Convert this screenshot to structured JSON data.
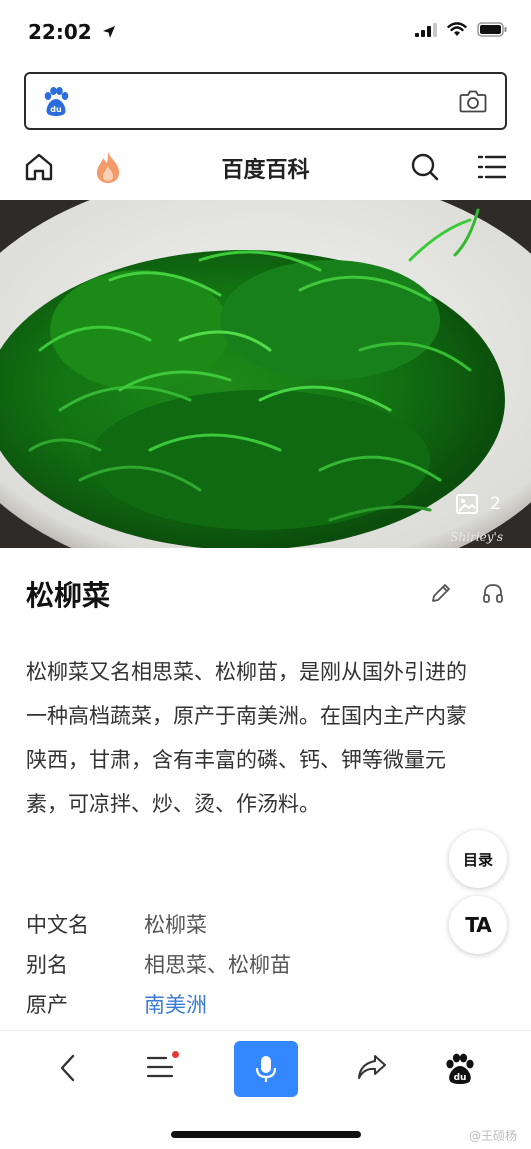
{
  "status_bar": {
    "time": "22:02"
  },
  "header": {
    "title": "百度百科"
  },
  "hero": {
    "image_count": "2",
    "watermark": "Shirley's"
  },
  "entry": {
    "title": "松柳菜",
    "summary": "松柳菜又名相思菜、松柳苗，是刚从国外引进的一种高档蔬菜，原产于南美洲。在国内主产内蒙陕西，甘肃，含有丰富的磷、钙、钾等微量元素，可凉拌、炒、烫、作汤料。"
  },
  "infobox": [
    {
      "key": "中文名",
      "value": "松柳菜"
    },
    {
      "key": "别名",
      "value": "相思菜、松柳苗"
    },
    {
      "key": "原产",
      "value": "南美洲"
    }
  ],
  "floating": {
    "toc_label": "目录",
    "ta_label": "TA"
  },
  "weibo_watermark": "@王硕杨",
  "icons": [
    "location-arrow-icon",
    "signal-icon",
    "wifi-icon",
    "battery-icon",
    "baidu-paw-icon",
    "camera-icon",
    "home-icon",
    "fire-icon",
    "search-icon",
    "menu-icon",
    "gallery-icon",
    "edit-icon",
    "headphones-icon",
    "back-icon",
    "microphone-icon",
    "share-icon"
  ],
  "colors": {
    "accent": "#3388ff",
    "link": "#3a7bd5",
    "badge": "#e53935",
    "fire": "#f39a6b"
  }
}
